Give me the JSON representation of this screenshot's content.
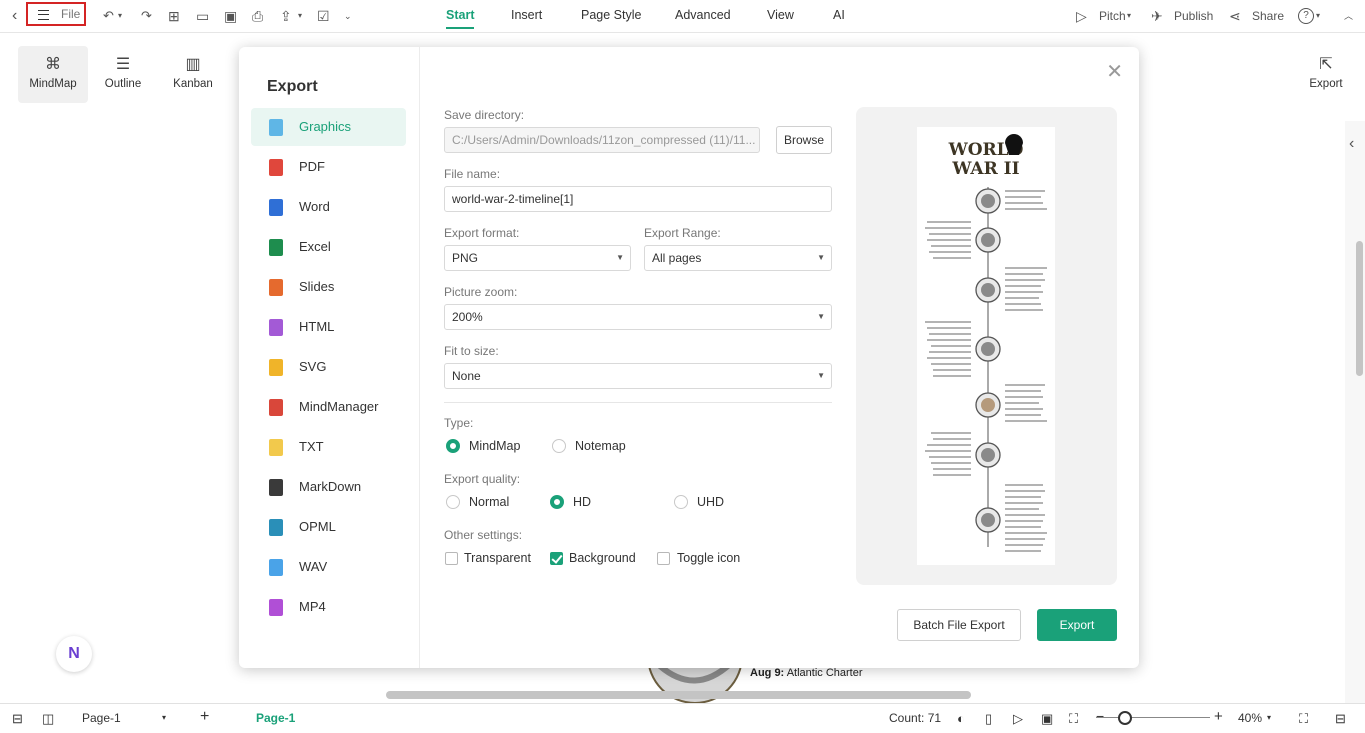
{
  "topbar": {
    "file_label": "File",
    "tabs": [
      "Start",
      "Insert",
      "Page Style",
      "Advanced",
      "View",
      "AI"
    ],
    "active_tab": "Start",
    "pitch_label": "Pitch",
    "publish_label": "Publish",
    "share_label": "Share",
    "help_label": "?"
  },
  "toolbar": {
    "views": [
      "MindMap",
      "Outline",
      "Kanban"
    ],
    "selected_view": "MindMap",
    "export_label": "Export"
  },
  "canvas": {
    "partial_line1_date": "Aug 9:",
    "partial_line1_text": "Atlantic Charter"
  },
  "dialog": {
    "title": "Export",
    "formats": [
      "Graphics",
      "PDF",
      "Word",
      "Excel",
      "Slides",
      "HTML",
      "SVG",
      "MindManager",
      "TXT",
      "MarkDown",
      "OPML",
      "WAV",
      "MP4"
    ],
    "selected_format": "Graphics",
    "save_directory_label": "Save directory:",
    "save_directory_value": "C:/Users/Admin/Downloads/11zon_compressed (11)/11...",
    "browse_label": "Browse",
    "file_name_label": "File name:",
    "file_name_value": "world-war-2-timeline[1]",
    "export_format_label": "Export format:",
    "export_format_value": "PNG",
    "export_range_label": "Export Range:",
    "export_range_value": "All pages",
    "picture_zoom_label": "Picture zoom:",
    "picture_zoom_value": "200%",
    "fit_to_size_label": "Fit to size:",
    "fit_to_size_value": "None",
    "type_label": "Type:",
    "type_options": [
      "MindMap",
      "Notemap"
    ],
    "type_selected": "MindMap",
    "quality_label": "Export quality:",
    "quality_options": [
      "Normal",
      "HD",
      "UHD"
    ],
    "quality_selected": "HD",
    "other_label": "Other settings:",
    "other_options": [
      {
        "label": "Transparent",
        "checked": false
      },
      {
        "label": "Background",
        "checked": true
      },
      {
        "label": "Toggle icon",
        "checked": false
      }
    ],
    "batch_label": "Batch File Export",
    "export_label": "Export",
    "preview_title_line1": "WORLD",
    "preview_title_line2": "WAR II"
  },
  "statusbar": {
    "page_select": "Page-1",
    "page_tab": "Page-1",
    "count": "Count: 71",
    "zoom": "40%",
    "zoom_level": 0.25
  },
  "colors": {
    "accent": "#1aa179",
    "highlight_border": "#d42424"
  }
}
